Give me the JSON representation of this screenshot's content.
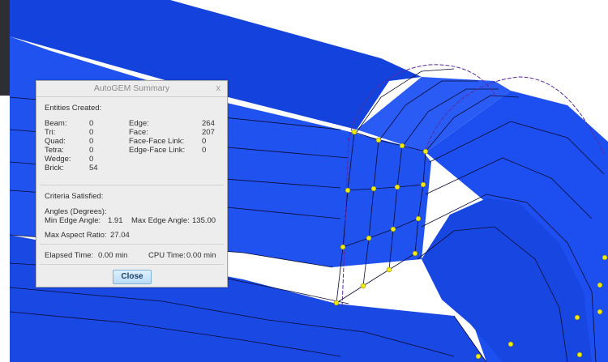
{
  "dialog": {
    "title": "AutoGEM Summary",
    "close_glyph": "x",
    "entities_heading": "Entities Created:",
    "entities_left": [
      {
        "label": "Beam:",
        "value": "0"
      },
      {
        "label": "Tri:",
        "value": "0"
      },
      {
        "label": "Quad:",
        "value": "0"
      },
      {
        "label": "Tetra:",
        "value": "0"
      },
      {
        "label": "Wedge:",
        "value": "0"
      },
      {
        "label": "Brick:",
        "value": "54"
      }
    ],
    "entities_right": [
      {
        "label": "Edge:",
        "value": "264"
      },
      {
        "label": "Face:",
        "value": "207"
      },
      {
        "label": "Face-Face Link:",
        "value": "0"
      },
      {
        "label": "Edge-Face Link:",
        "value": "0"
      }
    ],
    "criteria_heading": "Criteria Satisfied:",
    "angles_heading": "Angles (Degrees):",
    "min_edge_angle_label": "Min Edge Angle:",
    "min_edge_angle_value": "1.91",
    "max_edge_angle_label": "Max Edge Angle:",
    "max_edge_angle_value": "135.00",
    "max_aspect_ratio_label": "Max Aspect Ratio:",
    "max_aspect_ratio_value": "27.04",
    "elapsed_label": "Elapsed Time:",
    "elapsed_value": "0.00 min",
    "cpu_label": "CPU Time:",
    "cpu_value": "0.00 min",
    "close_button_label": "Close"
  },
  "colors": {
    "model_face": "#1f52ee",
    "model_top": "#123fd6",
    "mesh_line": "#0a0a33",
    "mesh_node": "#f2ea10",
    "dialog_bg": "#ededed",
    "button_border": "#7fb0d9"
  }
}
